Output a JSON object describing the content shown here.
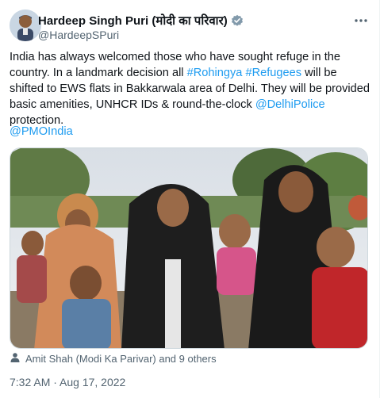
{
  "author": {
    "name": "Hardeep Singh Puri (मोदी का परिवार)",
    "handle": "@HardeepSPuri",
    "verified_color": "#829aab"
  },
  "tweet": {
    "text_segments": [
      "India has always welcomed those who have sought refuge in the country. In a landmark decision all ",
      "#Rohingya",
      " ",
      "#Refugees",
      " will be shifted to EWS flats in Bakkarwala area of Delhi. They will be provided basic amenities, UNHCR IDs & round-the-clock ",
      "@DelhiPolice",
      " protection."
    ],
    "mention": "@PMOIndia",
    "tagged": "Amit Shah (Modi Ka Parivar) and 9 others",
    "timestamp": "7:32 AM · Aug 17, 2022"
  },
  "colors": {
    "link": "#1d9bf0",
    "secondary_text": "#536471"
  },
  "icons": {
    "more": "more-icon",
    "verified": "verified-badge-icon",
    "tag": "person-tag-icon"
  }
}
